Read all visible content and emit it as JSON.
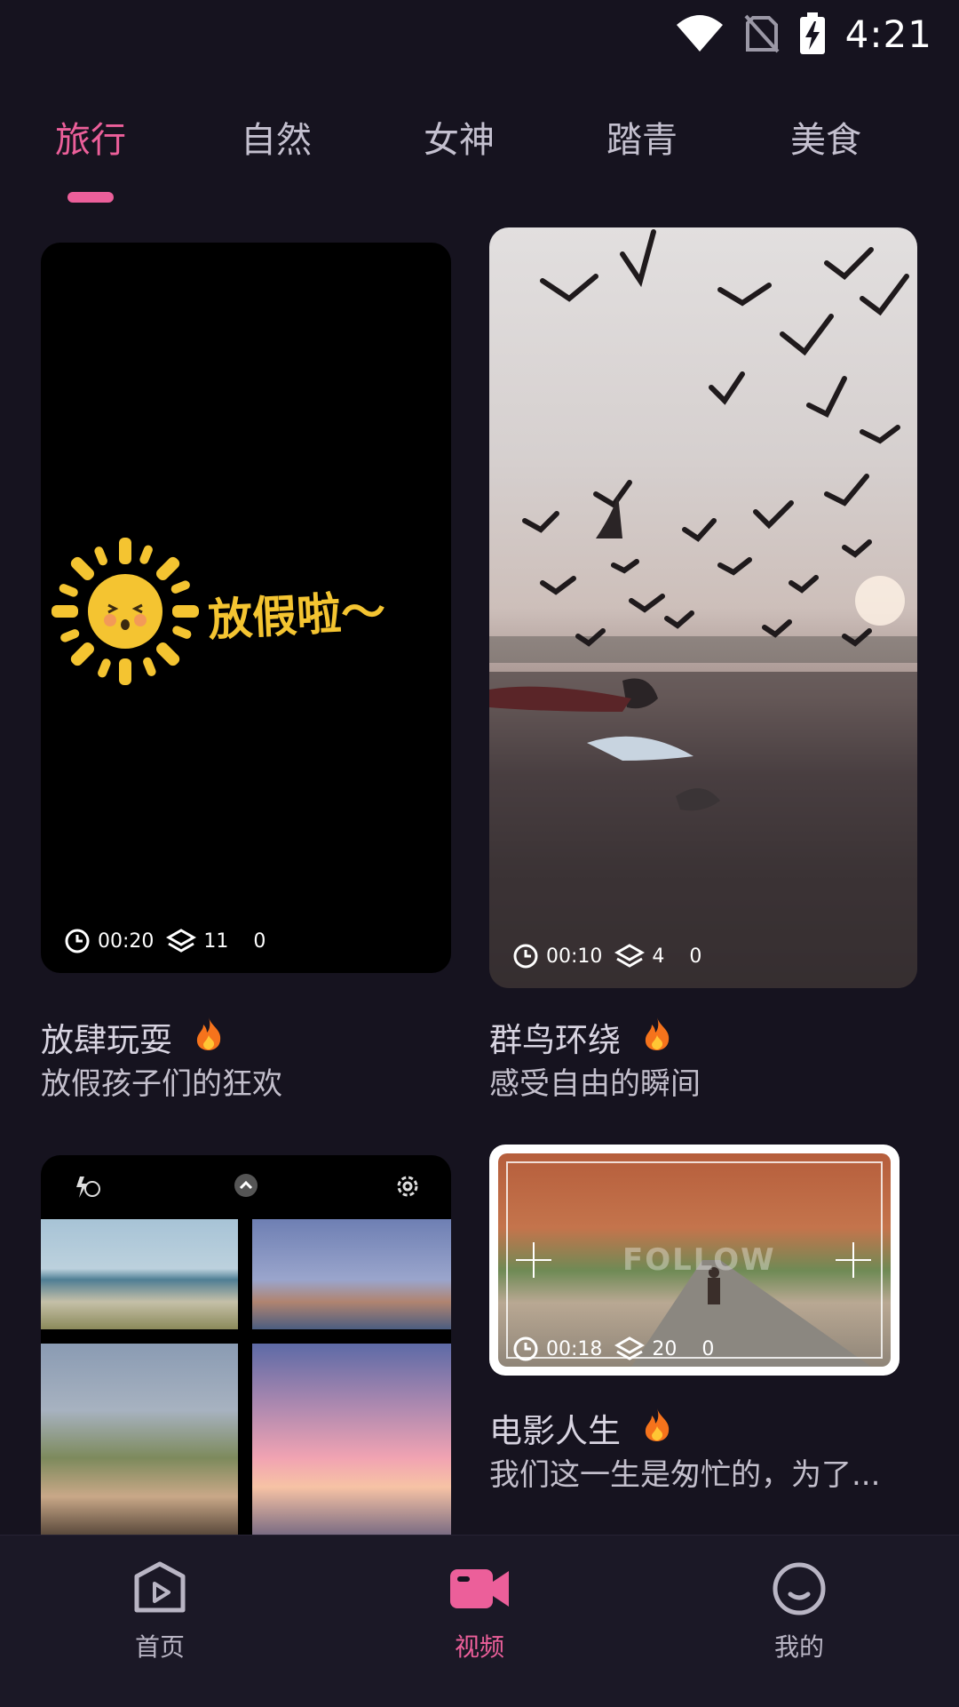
{
  "status": {
    "time": "4:21"
  },
  "tabs": [
    {
      "label": "旅行",
      "active": true
    },
    {
      "label": "自然",
      "active": false
    },
    {
      "label": "女神",
      "active": false
    },
    {
      "label": "踏青",
      "active": false
    },
    {
      "label": "美食",
      "active": false
    }
  ],
  "cards": [
    {
      "duration": "00:20",
      "layers": "11",
      "count": "0",
      "overlay_text": "放假啦～",
      "title": "放肆玩耍",
      "subtitle": "放假孩子们的狂欢"
    },
    {
      "duration": "00:10",
      "layers": "4",
      "count": "0",
      "title": "群鸟环绕",
      "subtitle": "感受自由的瞬间"
    },
    {
      "title": "",
      "subtitle": ""
    },
    {
      "duration": "00:18",
      "layers": "20",
      "count": "0",
      "overlay_text": "FOLLOW",
      "title": "电影人生",
      "subtitle": "我们这一生是匆忙的，为了..."
    }
  ],
  "bottom_nav": [
    {
      "label": "首页",
      "icon": "play-icon",
      "active": false
    },
    {
      "label": "视频",
      "icon": "video-camera-icon",
      "active": true
    },
    {
      "label": "我的",
      "icon": "smile-icon",
      "active": false
    }
  ],
  "colors": {
    "accent": "#ec5f9a",
    "background": "#16131f"
  }
}
